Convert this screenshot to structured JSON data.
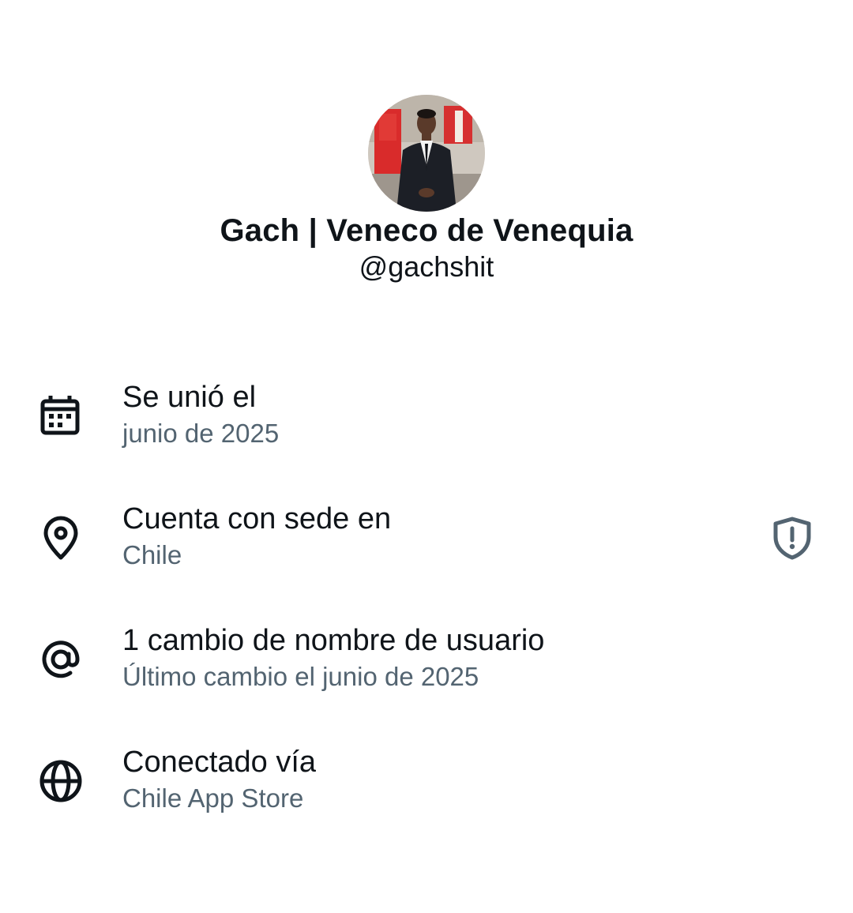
{
  "profile": {
    "display_name": "Gach | Veneco de Venequia",
    "handle": "@gachshit",
    "avatar_icon": "profile-photo"
  },
  "info": [
    {
      "icon": "calendar-icon",
      "title": "Se unió el",
      "subtitle": "junio de 2025"
    },
    {
      "icon": "location-pin-icon",
      "title": "Cuenta con sede en",
      "subtitle": "Chile",
      "trailing_icon": "shield-alert-icon"
    },
    {
      "icon": "at-sign-icon",
      "title": "1 cambio de nombre de usuario",
      "subtitle": "Último cambio el junio de 2025"
    },
    {
      "icon": "globe-icon",
      "title": "Conectado vía",
      "subtitle": "Chile App Store"
    }
  ],
  "colors": {
    "primary_text": "#0f1419",
    "secondary_text": "#536471",
    "shield_icon": "#536471"
  }
}
